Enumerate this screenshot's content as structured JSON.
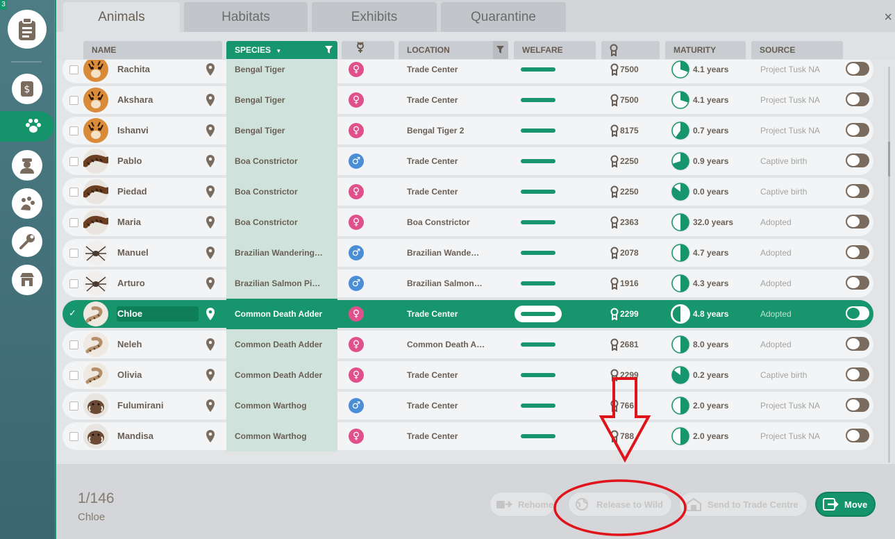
{
  "sidebar": {
    "corner_badge": "3",
    "buttons": [
      {
        "icon": "clipboard-icon"
      },
      {
        "icon": "finances-icon"
      },
      {
        "icon": "paw-icon",
        "active": true
      },
      {
        "icon": "staff-icon"
      },
      {
        "icon": "animal-care-icon"
      },
      {
        "icon": "maintenance-icon"
      },
      {
        "icon": "shop-icon"
      }
    ]
  },
  "tabs": [
    {
      "label": "Animals",
      "active": true
    },
    {
      "label": "Habitats"
    },
    {
      "label": "Exhibits"
    },
    {
      "label": "Quarantine"
    }
  ],
  "close_icon": "×",
  "columns": {
    "name": "NAME",
    "species": "SPECIES",
    "gender_icon": "gender-icon",
    "location": "LOCATION",
    "welfare": "WELFARE",
    "reputation_icon": "reputation-icon",
    "maturity": "MATURITY",
    "source": "SOURCE"
  },
  "rows": [
    {
      "name": "Rachita",
      "species": "Bengal Tiger",
      "gender": "female",
      "location": "Trade Center",
      "rep": "7500",
      "maturity": "4.1 years",
      "mat_frac": 0.3,
      "source": "Project Tusk NA",
      "kind": "tiger"
    },
    {
      "name": "Akshara",
      "species": "Bengal Tiger",
      "gender": "female",
      "location": "Trade Center",
      "rep": "7500",
      "maturity": "4.1 years",
      "mat_frac": 0.3,
      "source": "Project Tusk NA",
      "kind": "tiger"
    },
    {
      "name": "Ishanvi",
      "species": "Bengal Tiger",
      "gender": "female",
      "location": "Bengal Tiger 2",
      "rep": "8175",
      "maturity": "0.7 years",
      "mat_frac": 0.6,
      "source": "Project Tusk NA",
      "kind": "tiger"
    },
    {
      "name": "Pablo",
      "species": "Boa Constrictor",
      "gender": "male",
      "location": "Trade Center",
      "rep": "2250",
      "maturity": "0.9 years",
      "mat_frac": 0.7,
      "source": "Captive birth",
      "kind": "snake"
    },
    {
      "name": "Piedad",
      "species": "Boa Constrictor",
      "gender": "female",
      "location": "Trade Center",
      "rep": "2250",
      "maturity": "0.0 years",
      "mat_frac": 0.85,
      "source": "Captive birth",
      "kind": "snake"
    },
    {
      "name": "Maria",
      "species": "Boa Constrictor",
      "gender": "female",
      "location": "Boa Constrictor",
      "rep": "2363",
      "maturity": "32.0 years",
      "mat_frac": 0.5,
      "source": "Adopted",
      "kind": "snake"
    },
    {
      "name": "Manuel",
      "species": "Brazilian Wandering…",
      "gender": "male",
      "location": "Brazilian Wande…",
      "rep": "2078",
      "maturity": "4.7 years",
      "mat_frac": 0.5,
      "source": "Adopted",
      "kind": "spider"
    },
    {
      "name": "Arturo",
      "species": "Brazilian Salmon Pi…",
      "gender": "male",
      "location": "Brazilian Salmon…",
      "rep": "1916",
      "maturity": "4.3 years",
      "mat_frac": 0.5,
      "source": "Adopted",
      "kind": "spider"
    },
    {
      "name": "Chloe",
      "species": "Common Death Adder",
      "gender": "female",
      "location": "Trade Center",
      "rep": "2299",
      "maturity": "4.8 years",
      "mat_frac": 0.5,
      "source": "Adopted",
      "kind": "adder",
      "selected": true
    },
    {
      "name": "Neleh",
      "species": "Common Death Adder",
      "gender": "female",
      "location": "Common Death A…",
      "rep": "2681",
      "maturity": "8.0 years",
      "mat_frac": 0.5,
      "source": "Adopted",
      "kind": "adder"
    },
    {
      "name": "Olivia",
      "species": "Common Death Adder",
      "gender": "female",
      "location": "Trade Center",
      "rep": "2299",
      "maturity": "0.2 years",
      "mat_frac": 0.85,
      "source": "Captive birth",
      "kind": "adder"
    },
    {
      "name": "Fulumirani",
      "species": "Common Warthog",
      "gender": "male",
      "location": "Trade Center",
      "rep": "766",
      "maturity": "2.0 years",
      "mat_frac": 0.5,
      "source": "Project Tusk NA",
      "kind": "warthog"
    },
    {
      "name": "Mandisa",
      "species": "Common Warthog",
      "gender": "female",
      "location": "Trade Center",
      "rep": "788",
      "maturity": "2.0 years",
      "mat_frac": 0.5,
      "source": "Project Tusk NA",
      "kind": "warthog"
    }
  ],
  "footer": {
    "count": "1/146",
    "selected_name": "Chloe",
    "rehome": "Rehome",
    "release": "Release to Wild",
    "trade": "Send to Trade Centre",
    "move": "Move"
  },
  "colors": {
    "accent": "#17956d",
    "female": "#e0508a",
    "male": "#4a8fd6",
    "annotation": "#e0141b"
  }
}
